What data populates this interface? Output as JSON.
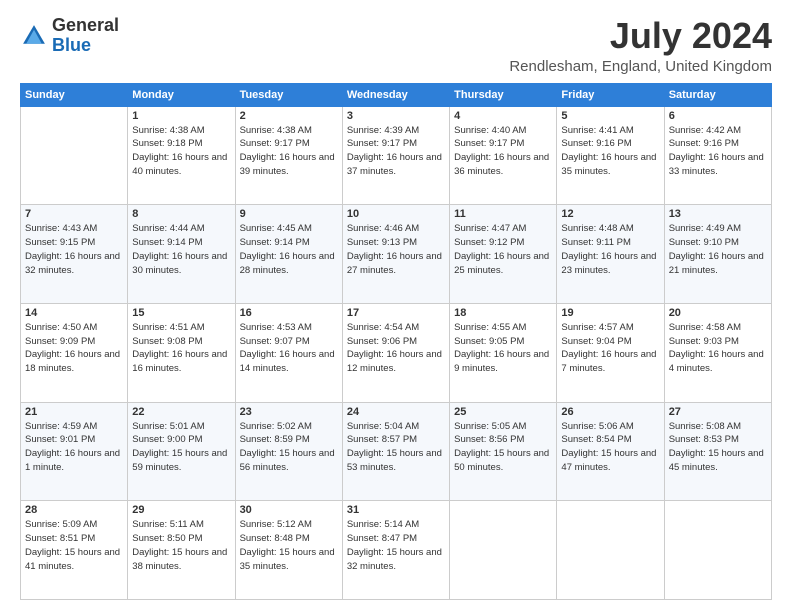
{
  "header": {
    "logo": {
      "general": "General",
      "blue": "Blue"
    },
    "title": "July 2024",
    "location": "Rendlesham, England, United Kingdom"
  },
  "weekdays": [
    "Sunday",
    "Monday",
    "Tuesday",
    "Wednesday",
    "Thursday",
    "Friday",
    "Saturday"
  ],
  "weeks": [
    [
      {
        "day": null,
        "info": null
      },
      {
        "day": "1",
        "sunrise": "4:38 AM",
        "sunset": "9:18 PM",
        "daylight": "16 hours and 40 minutes."
      },
      {
        "day": "2",
        "sunrise": "4:38 AM",
        "sunset": "9:17 PM",
        "daylight": "16 hours and 39 minutes."
      },
      {
        "day": "3",
        "sunrise": "4:39 AM",
        "sunset": "9:17 PM",
        "daylight": "16 hours and 37 minutes."
      },
      {
        "day": "4",
        "sunrise": "4:40 AM",
        "sunset": "9:17 PM",
        "daylight": "16 hours and 36 minutes."
      },
      {
        "day": "5",
        "sunrise": "4:41 AM",
        "sunset": "9:16 PM",
        "daylight": "16 hours and 35 minutes."
      },
      {
        "day": "6",
        "sunrise": "4:42 AM",
        "sunset": "9:16 PM",
        "daylight": "16 hours and 33 minutes."
      }
    ],
    [
      {
        "day": "7",
        "sunrise": "4:43 AM",
        "sunset": "9:15 PM",
        "daylight": "16 hours and 32 minutes."
      },
      {
        "day": "8",
        "sunrise": "4:44 AM",
        "sunset": "9:14 PM",
        "daylight": "16 hours and 30 minutes."
      },
      {
        "day": "9",
        "sunrise": "4:45 AM",
        "sunset": "9:14 PM",
        "daylight": "16 hours and 28 minutes."
      },
      {
        "day": "10",
        "sunrise": "4:46 AM",
        "sunset": "9:13 PM",
        "daylight": "16 hours and 27 minutes."
      },
      {
        "day": "11",
        "sunrise": "4:47 AM",
        "sunset": "9:12 PM",
        "daylight": "16 hours and 25 minutes."
      },
      {
        "day": "12",
        "sunrise": "4:48 AM",
        "sunset": "9:11 PM",
        "daylight": "16 hours and 23 minutes."
      },
      {
        "day": "13",
        "sunrise": "4:49 AM",
        "sunset": "9:10 PM",
        "daylight": "16 hours and 21 minutes."
      }
    ],
    [
      {
        "day": "14",
        "sunrise": "4:50 AM",
        "sunset": "9:09 PM",
        "daylight": "16 hours and 18 minutes."
      },
      {
        "day": "15",
        "sunrise": "4:51 AM",
        "sunset": "9:08 PM",
        "daylight": "16 hours and 16 minutes."
      },
      {
        "day": "16",
        "sunrise": "4:53 AM",
        "sunset": "9:07 PM",
        "daylight": "16 hours and 14 minutes."
      },
      {
        "day": "17",
        "sunrise": "4:54 AM",
        "sunset": "9:06 PM",
        "daylight": "16 hours and 12 minutes."
      },
      {
        "day": "18",
        "sunrise": "4:55 AM",
        "sunset": "9:05 PM",
        "daylight": "16 hours and 9 minutes."
      },
      {
        "day": "19",
        "sunrise": "4:57 AM",
        "sunset": "9:04 PM",
        "daylight": "16 hours and 7 minutes."
      },
      {
        "day": "20",
        "sunrise": "4:58 AM",
        "sunset": "9:03 PM",
        "daylight": "16 hours and 4 minutes."
      }
    ],
    [
      {
        "day": "21",
        "sunrise": "4:59 AM",
        "sunset": "9:01 PM",
        "daylight": "16 hours and 1 minute."
      },
      {
        "day": "22",
        "sunrise": "5:01 AM",
        "sunset": "9:00 PM",
        "daylight": "15 hours and 59 minutes."
      },
      {
        "day": "23",
        "sunrise": "5:02 AM",
        "sunset": "8:59 PM",
        "daylight": "15 hours and 56 minutes."
      },
      {
        "day": "24",
        "sunrise": "5:04 AM",
        "sunset": "8:57 PM",
        "daylight": "15 hours and 53 minutes."
      },
      {
        "day": "25",
        "sunrise": "5:05 AM",
        "sunset": "8:56 PM",
        "daylight": "15 hours and 50 minutes."
      },
      {
        "day": "26",
        "sunrise": "5:06 AM",
        "sunset": "8:54 PM",
        "daylight": "15 hours and 47 minutes."
      },
      {
        "day": "27",
        "sunrise": "5:08 AM",
        "sunset": "8:53 PM",
        "daylight": "15 hours and 45 minutes."
      }
    ],
    [
      {
        "day": "28",
        "sunrise": "5:09 AM",
        "sunset": "8:51 PM",
        "daylight": "15 hours and 41 minutes."
      },
      {
        "day": "29",
        "sunrise": "5:11 AM",
        "sunset": "8:50 PM",
        "daylight": "15 hours and 38 minutes."
      },
      {
        "day": "30",
        "sunrise": "5:12 AM",
        "sunset": "8:48 PM",
        "daylight": "15 hours and 35 minutes."
      },
      {
        "day": "31",
        "sunrise": "5:14 AM",
        "sunset": "8:47 PM",
        "daylight": "15 hours and 32 minutes."
      },
      {
        "day": null,
        "info": null
      },
      {
        "day": null,
        "info": null
      },
      {
        "day": null,
        "info": null
      }
    ]
  ],
  "labels": {
    "sunrise_prefix": "Sunrise:",
    "sunset_prefix": "Sunset:",
    "daylight_prefix": "Daylight:"
  }
}
